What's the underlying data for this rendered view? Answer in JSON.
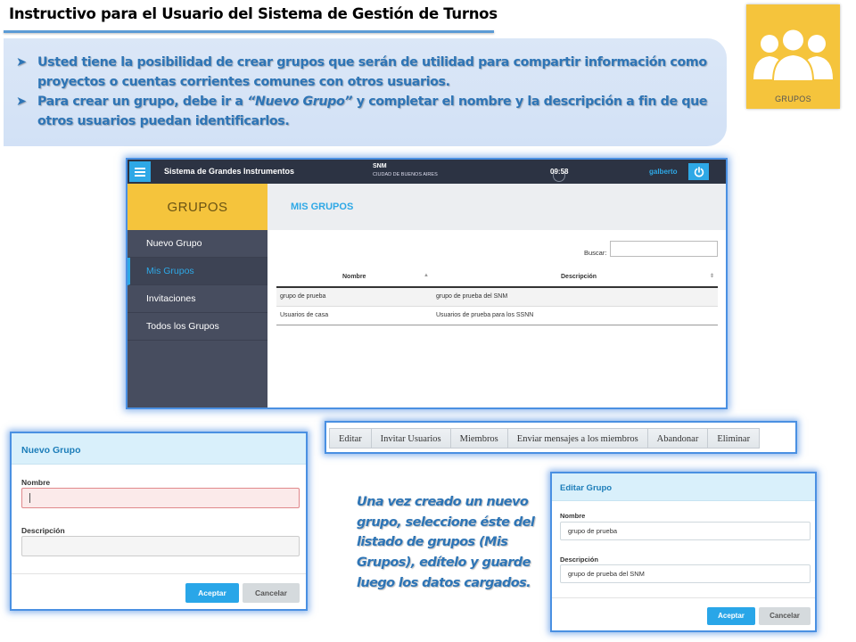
{
  "slide": {
    "title": "Instructivo para el Usuario del Sistema de Gestión de Turnos",
    "bullets": [
      {
        "text": "Usted tiene la posibilidad de crear grupos que serán de utilidad para compartir información como proyectos o cuentas corrientes comunes con otros usuarios."
      },
      {
        "before": "Para crear un grupo, debe ir a ",
        "emphasis": "“Nuevo Grupo”",
        "after": " y completar el nombre y la descripción a fin de que otros usuarios puedan identificarlos."
      }
    ],
    "bullet_icon": "arrow-bullet-icon",
    "accent_color": "#2e75b6",
    "callout": "Una vez creado un nuevo grupo, seleccione éste del listado de grupos (Mis Grupos), edítelo y guarde luego los datos cargados."
  },
  "groups_tile": {
    "label": "GRUPOS",
    "icon": "people-group-icon",
    "color": "#f5c43c"
  },
  "app": {
    "topbar": {
      "menu_icon": "hamburger-menu-icon",
      "title": "Sistema de Grandes Instrumentos",
      "org": "SNM",
      "city": "CIUDAD DE BUENOS AIRES",
      "time": "09:58",
      "user": "galberto",
      "power_icon": "power-icon"
    },
    "sidebar": {
      "header": "GRUPOS",
      "items": [
        {
          "label": "Nuevo Grupo"
        },
        {
          "label": "Mis Grupos",
          "active": true
        },
        {
          "label": "Invitaciones"
        },
        {
          "label": "Todos los Grupos"
        }
      ]
    },
    "content": {
      "heading": "MIS GRUPOS",
      "search_label": "Buscar:",
      "search_value": "",
      "columns": [
        "Nombre",
        "Descripción"
      ],
      "rows": [
        [
          "grupo de prueba",
          "grupo de prueba del SNM"
        ],
        [
          "Usuarios de casa",
          "Usuarios de prueba para los SSNN"
        ]
      ]
    }
  },
  "nuevo_grupo": {
    "title": "Nuevo Grupo",
    "nombre_label": "Nombre",
    "nombre_value": "",
    "descripcion_label": "Descripción",
    "descripcion_value": "",
    "accept": "Aceptar",
    "cancel": "Cancelar"
  },
  "toolbar": {
    "buttons": [
      "Editar",
      "Invitar Usuarios",
      "Miembros",
      "Enviar mensajes a los miembros",
      "Abandonar",
      "Eliminar"
    ]
  },
  "editar_grupo": {
    "title": "Editar Grupo",
    "nombre_label": "Nombre",
    "nombre_value": "grupo de prueba",
    "descripcion_label": "Descripción",
    "descripcion_value": "grupo de prueba del SNM",
    "accept": "Aceptar",
    "cancel": "Cancelar"
  }
}
